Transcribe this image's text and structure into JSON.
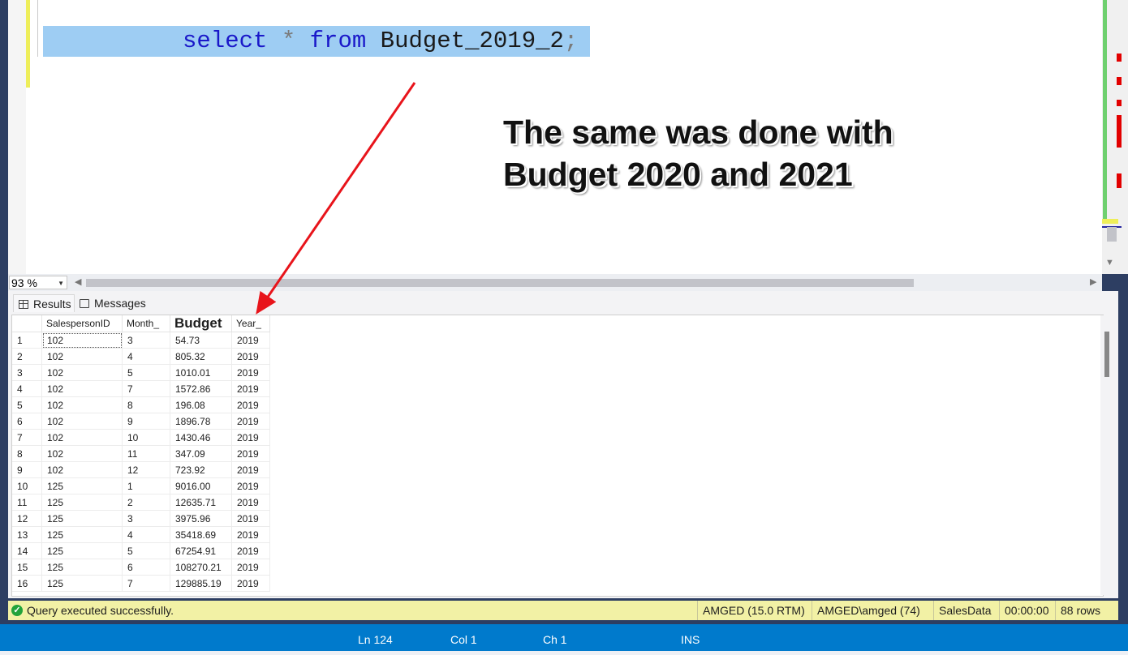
{
  "editor": {
    "code": {
      "kw1": "select",
      "star": "*",
      "kw2": "from",
      "table": "Budget_2019_2",
      "semi": ";"
    }
  },
  "annotation": {
    "line1": "The same was done with",
    "line2": "Budget 2020 and 2021"
  },
  "zoom": {
    "value": "93 %"
  },
  "tabs": {
    "results": "Results",
    "messages": "Messages"
  },
  "grid": {
    "columns": [
      "SalespersonID",
      "Month_",
      "Budget",
      "Year_"
    ],
    "rows": [
      [
        "1",
        "102",
        "3",
        "54.73",
        "2019"
      ],
      [
        "2",
        "102",
        "4",
        "805.32",
        "2019"
      ],
      [
        "3",
        "102",
        "5",
        "1010.01",
        "2019"
      ],
      [
        "4",
        "102",
        "7",
        "1572.86",
        "2019"
      ],
      [
        "5",
        "102",
        "8",
        "196.08",
        "2019"
      ],
      [
        "6",
        "102",
        "9",
        "1896.78",
        "2019"
      ],
      [
        "7",
        "102",
        "10",
        "1430.46",
        "2019"
      ],
      [
        "8",
        "102",
        "11",
        "347.09",
        "2019"
      ],
      [
        "9",
        "102",
        "12",
        "723.92",
        "2019"
      ],
      [
        "10",
        "125",
        "1",
        "9016.00",
        "2019"
      ],
      [
        "11",
        "125",
        "2",
        "12635.71",
        "2019"
      ],
      [
        "12",
        "125",
        "3",
        "3975.96",
        "2019"
      ],
      [
        "13",
        "125",
        "4",
        "35418.69",
        "2019"
      ],
      [
        "14",
        "125",
        "5",
        "67254.91",
        "2019"
      ],
      [
        "15",
        "125",
        "6",
        "108270.21",
        "2019"
      ],
      [
        "16",
        "125",
        "7",
        "129885.19",
        "2019"
      ]
    ]
  },
  "status": {
    "message": "Query executed successfully.",
    "server": "AMGED (15.0 RTM)",
    "user": "AMGED\\amged (74)",
    "database": "SalesData",
    "elapsed": "00:00:00",
    "rows": "88 rows"
  },
  "position": {
    "ln": "Ln 124",
    "col": "Col 1",
    "ch": "Ch 1",
    "mode": "INS"
  },
  "colors": {
    "selection": "#9ecdf3",
    "keyword": "#1a18c9",
    "arrow": "#e8141b",
    "statusbar": "#f2f1a5",
    "bottombar": "#007acc"
  }
}
